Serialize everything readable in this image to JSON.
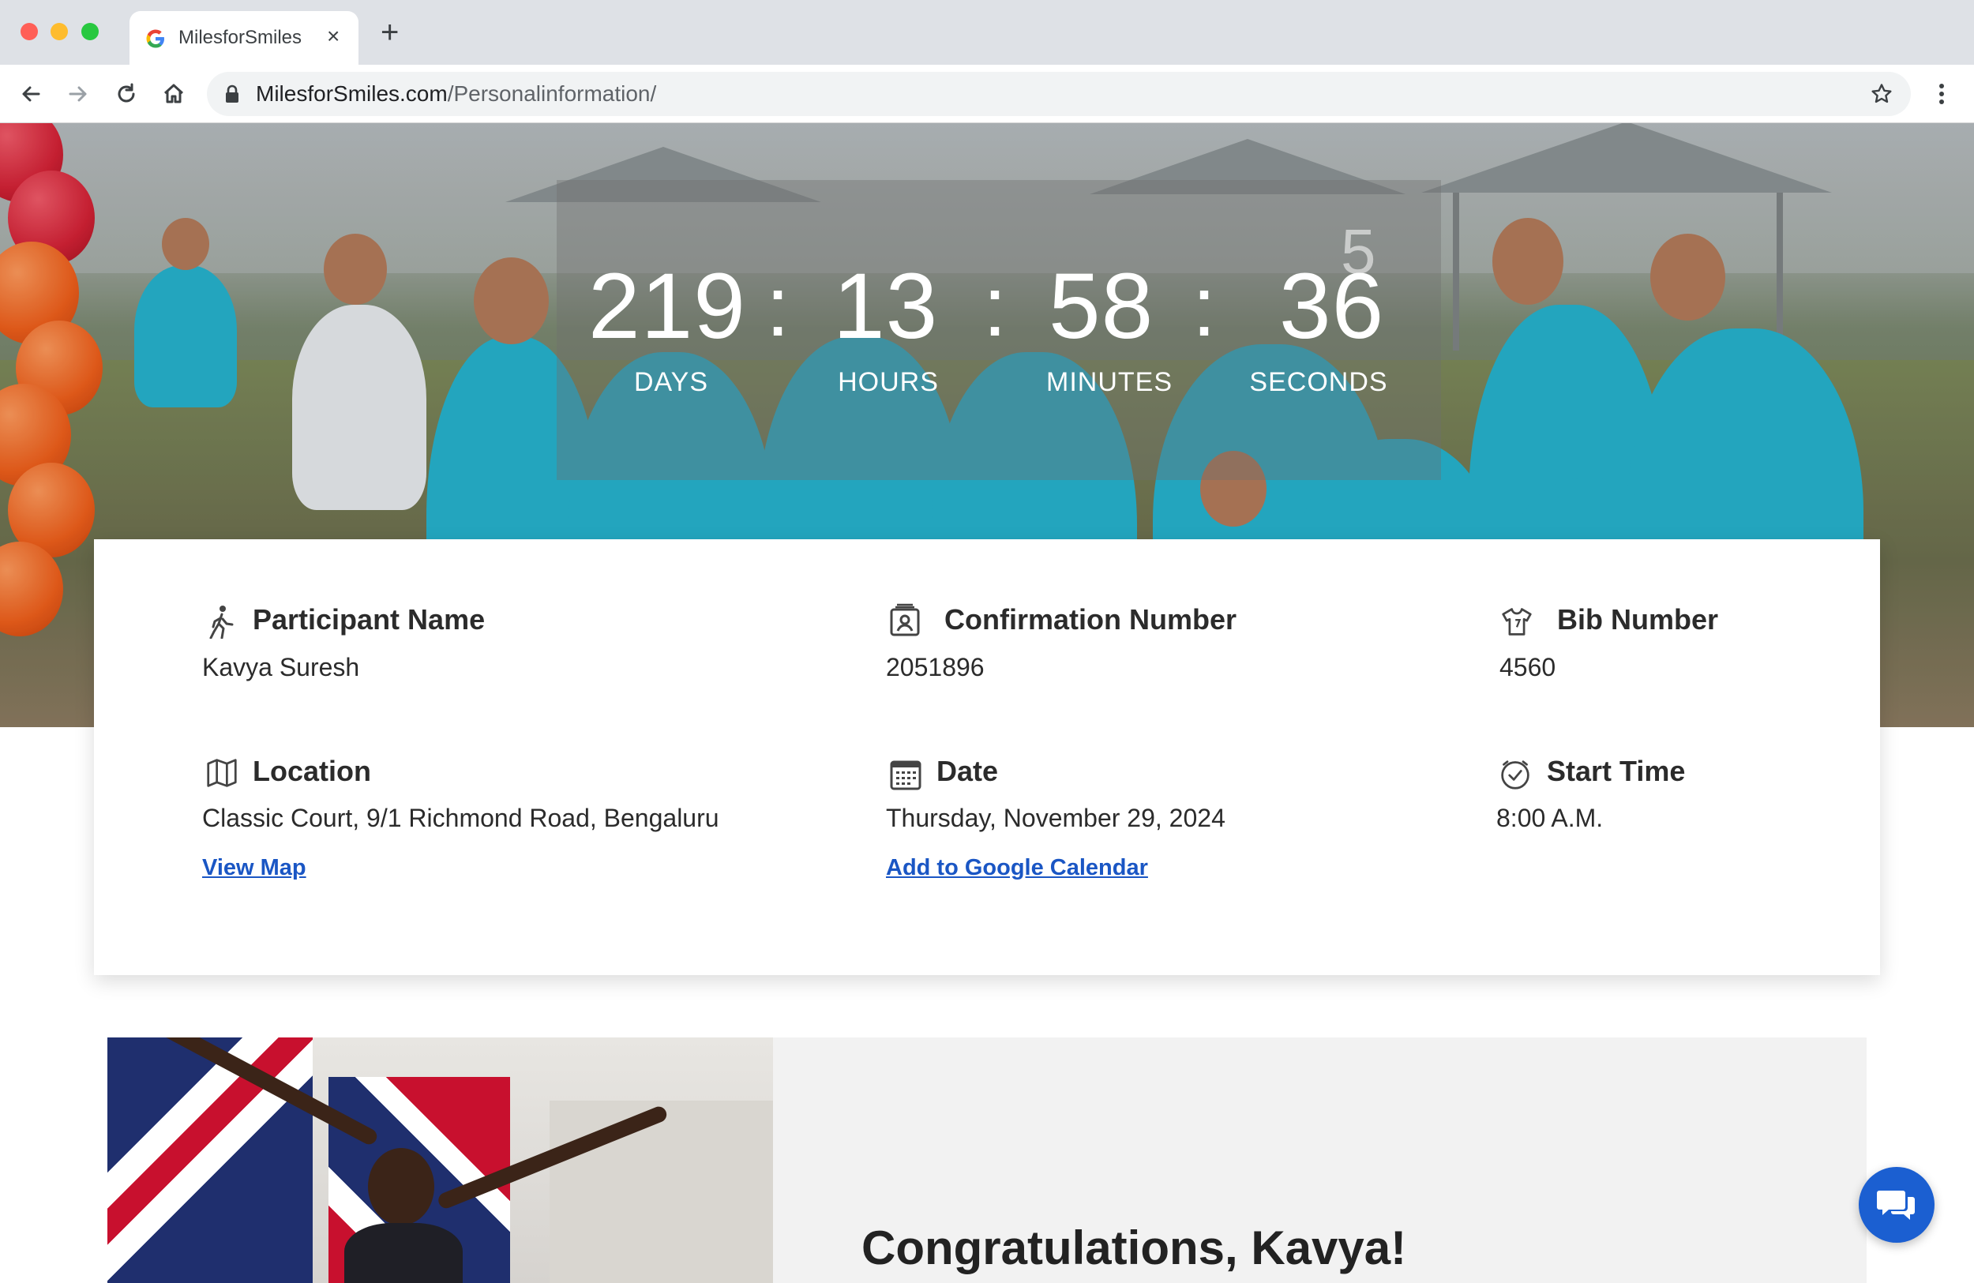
{
  "browser": {
    "tab_title": "MilesforSmiles",
    "url_domain": "MilesforSmiles.com",
    "url_path": "/Personalinformation/",
    "new_tab_symbol": "+",
    "close_symbol": "×"
  },
  "countdown": {
    "days": "219",
    "hours": "13",
    "minutes": "58",
    "seconds": "36",
    "seconds_next_digit": "5",
    "separator": ":",
    "labels": {
      "days": "DAYS",
      "hours": "HOURS",
      "minutes": "MINUTES",
      "seconds": "SECONDS"
    }
  },
  "details": {
    "participant": {
      "title": "Participant Name",
      "value": "Kavya Suresh"
    },
    "confirmation": {
      "title": "Confirmation Number",
      "value": "2051896"
    },
    "bib": {
      "title": "Bib Number",
      "value": "4560"
    },
    "location": {
      "title": "Location",
      "value": "Classic Court, 9/1 Richmond Road, Bengaluru",
      "link": "View Map"
    },
    "date": {
      "title": "Date",
      "value": "Thursday, November 29, 2024",
      "link": "Add to Google Calendar"
    },
    "start_time": {
      "title": "Start Time",
      "value": "8:00 A.M."
    }
  },
  "congrats": {
    "title": "Congratulations, Kavya!"
  },
  "colors": {
    "link": "#1a56c4",
    "chat_button": "#1b5fd1",
    "shirt": "#27b3cf"
  },
  "icons": [
    "google-favicon",
    "back-arrow-icon",
    "forward-arrow-icon",
    "reload-icon",
    "home-icon",
    "lock-icon",
    "star-icon",
    "kebab-menu-icon",
    "walking-person-icon",
    "id-badge-icon",
    "tshirt-icon",
    "map-icon",
    "calendar-icon",
    "clock-icon",
    "chat-bubbles-icon"
  ]
}
